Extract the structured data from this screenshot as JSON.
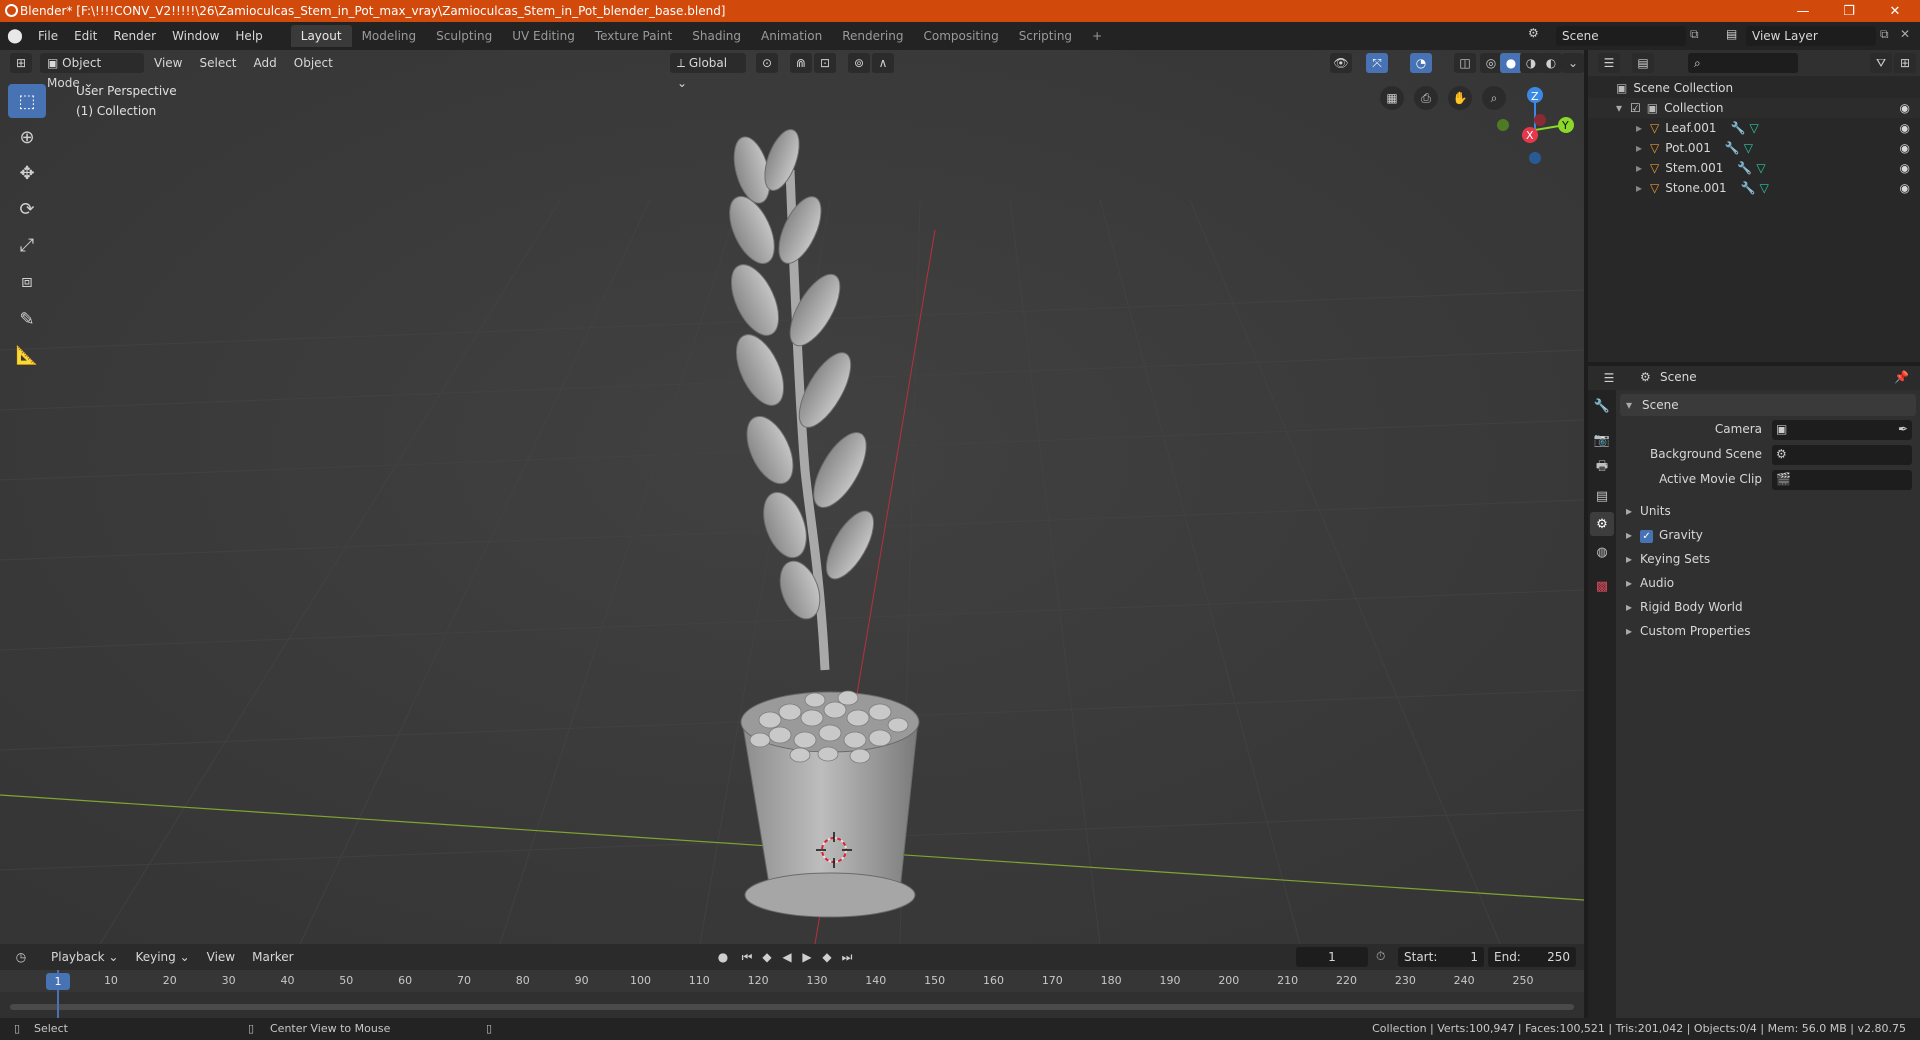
{
  "window": {
    "title": "Blender* [F:\\!!!!CONV_V2!!!!!\\26\\Zamioculcas_Stem_in_Pot_max_vray\\Zamioculcas_Stem_in_Pot_blender_base.blend]",
    "minimize": "—",
    "maximize": "❐",
    "close": "✕"
  },
  "menubar": {
    "menus": [
      "File",
      "Edit",
      "Render",
      "Window",
      "Help"
    ],
    "workspaces": [
      "Layout",
      "Modeling",
      "Sculpting",
      "UV Editing",
      "Texture Paint",
      "Shading",
      "Animation",
      "Rendering",
      "Compositing",
      "Scripting"
    ],
    "add_workspace": "+",
    "scene_name": "Scene",
    "view_layer_name": "View Layer"
  },
  "viewport": {
    "mode": "Object Mode",
    "menus": [
      "View",
      "Select",
      "Add",
      "Object"
    ],
    "orientation": "Global",
    "perspective_label": "User Perspective",
    "collection_label": "(1) Collection",
    "gizmo": {
      "z": "Z",
      "y": "Y",
      "x": "X"
    }
  },
  "outliner": {
    "root": "Scene Collection",
    "collection": "Collection",
    "items": [
      "Leaf.001",
      "Pot.001",
      "Stem.001",
      "Stone.001"
    ]
  },
  "properties": {
    "context": "Scene",
    "panel_title": "Scene",
    "camera_label": "Camera",
    "background_scene_label": "Background Scene",
    "active_movie_clip_label": "Active Movie Clip",
    "sections": [
      "Units",
      "Gravity",
      "Keying Sets",
      "Audio",
      "Rigid Body World",
      "Custom Properties"
    ],
    "gravity_checked": true
  },
  "timeline": {
    "menus": [
      "Playback",
      "Keying",
      "View",
      "Marker"
    ],
    "current_frame": "1",
    "start_label": "Start:",
    "start": "1",
    "end_label": "End:",
    "end": "250",
    "ticks": [
      "10",
      "20",
      "30",
      "40",
      "50",
      "60",
      "70",
      "80",
      "90",
      "100",
      "110",
      "120",
      "130",
      "140",
      "150",
      "160",
      "170",
      "180",
      "190",
      "200",
      "210",
      "220",
      "230",
      "240",
      "250"
    ],
    "playhead": "1"
  },
  "statusbar": {
    "select": "Select",
    "center_view": "Center View to Mouse",
    "stats": "Collection | Verts:100,947 | Faces:100,521 | Tris:201,042 | Objects:0/4 | Mem: 56.0 MB | v2.80.75"
  },
  "colors": {
    "accent": "#4772b3",
    "titlebar": "#d14a0c",
    "viewport_bg": "#3c3c3c",
    "object_icon": "#e59a37",
    "modifier_icon": "#5aa0e0",
    "mesh_icon": "#2ec7a2",
    "x_axis": "#e5384a",
    "y_axis": "#8bd72a",
    "z_axis": "#3a8ae5"
  }
}
